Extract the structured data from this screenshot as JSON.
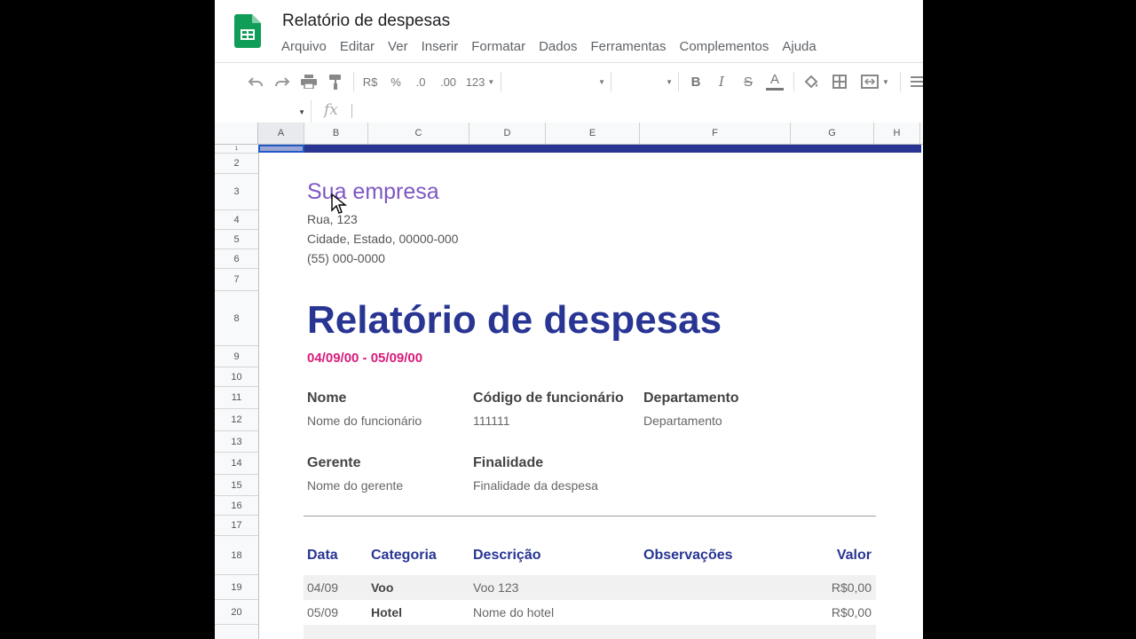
{
  "app": {
    "doc_title": "Relatório de despesas",
    "menu": [
      "Arquivo",
      "Editar",
      "Ver",
      "Inserir",
      "Formatar",
      "Dados",
      "Ferramentas",
      "Complementos",
      "Ajuda"
    ],
    "brand_color": "#0f9d58"
  },
  "toolbar": {
    "currency": "R$",
    "percent": "%",
    "dec_decrease": ".0",
    "dec_increase": ".00",
    "number_format": "123",
    "bold": "B",
    "italic": "I",
    "strike": "S",
    "text_color": "A"
  },
  "formula": {
    "fx": "fx",
    "cell_ref": ""
  },
  "columns": [
    "A",
    "B",
    "C",
    "D",
    "E",
    "F",
    "G",
    "H"
  ],
  "rows": [
    "1",
    "2",
    "3",
    "4",
    "5",
    "6",
    "7",
    "8",
    "9",
    "10",
    "11",
    "12",
    "13",
    "14",
    "15",
    "16",
    "17",
    "18",
    "19",
    "20"
  ],
  "sheet": {
    "company": "Sua empresa",
    "address_line1": "Rua, 123",
    "address_line2": "Cidade, Estado, 00000-000",
    "phone": "(55) 000-0000",
    "title": "Relatório de despesas",
    "date_range": "04/09/00 - 05/09/00",
    "fields": {
      "name_label": "Nome",
      "name_value": "Nome do funcionário",
      "code_label": "Código de funcionário",
      "code_value": "111111",
      "dept_label": "Departamento",
      "dept_value": "Departamento",
      "manager_label": "Gerente",
      "manager_value": "Nome do gerente",
      "purpose_label": "Finalidade",
      "purpose_value": "Finalidade da despesa"
    },
    "table": {
      "headers": [
        "Data",
        "Categoria",
        "Descrição",
        "Observações",
        "Valor"
      ],
      "rows": [
        [
          "04/09",
          "Voo",
          "Voo 123",
          "",
          "R$0,00"
        ],
        [
          "05/09",
          "Hotel",
          "Nome do hotel",
          "",
          "R$0,00"
        ]
      ]
    },
    "colors": {
      "title": "#283593",
      "company": "#7e57c2",
      "date": "#d81b7a"
    }
  }
}
